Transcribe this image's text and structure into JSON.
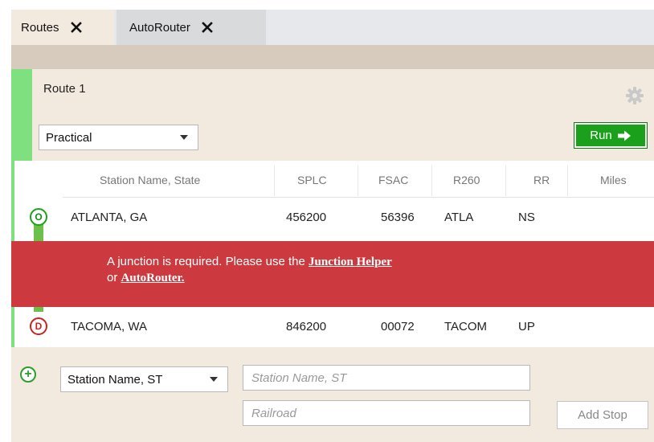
{
  "tabs": [
    {
      "label": "Routes",
      "active": true
    },
    {
      "label": "AutoRouter",
      "active": false
    }
  ],
  "route": {
    "title": "Route 1",
    "mode_select": {
      "value": "Practical"
    },
    "run_label": "Run"
  },
  "table": {
    "columns": [
      "Station Name, State",
      "SPLC",
      "FSAC",
      "R260",
      "RR",
      "Miles"
    ],
    "rows": [
      {
        "badge": "O",
        "station": "ATLANTA, GA",
        "splc": "456200",
        "fsac": "56396",
        "r260": "ATLA",
        "rr": "NS",
        "miles": ""
      },
      {
        "badge": "D",
        "station": "TACOMA, WA",
        "splc": "846200",
        "fsac": "00072",
        "r260": "TACOM",
        "rr": "UP",
        "miles": ""
      }
    ]
  },
  "alert": {
    "text_before": "A junction is required. Please use the ",
    "link1": "Junction Helper",
    "text_mid": "or ",
    "link2": "AutoRouter."
  },
  "add_stop": {
    "type_select": {
      "value": "Station Name, ST"
    },
    "station_placeholder": "Station Name, ST",
    "railroad_placeholder": "Railroad",
    "button_label": "Add Stop"
  },
  "colors": {
    "accent_green": "#1aa01a",
    "alert_red": "#cc3a3f",
    "panel_bg": "#f3eadf"
  }
}
